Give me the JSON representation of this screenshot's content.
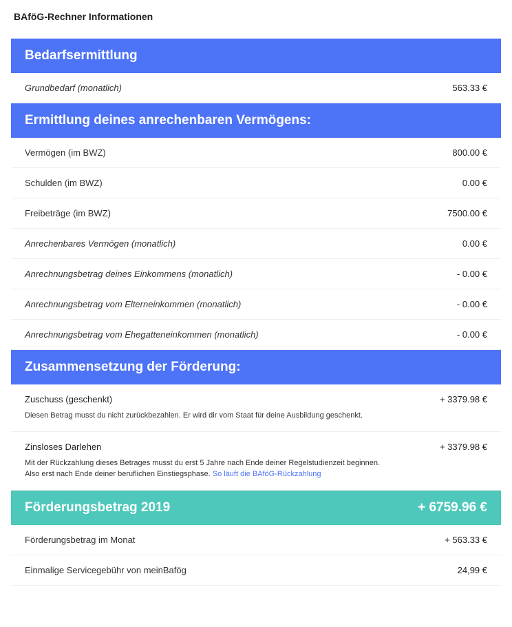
{
  "title": "BAföG-Rechner Informationen",
  "sections": {
    "bedarf": {
      "header": "Bedarfsermittlung",
      "rows": [
        {
          "label": "Grundbedarf (monatlich)",
          "value": "563.33 €",
          "italic": true
        }
      ]
    },
    "vermoegen": {
      "header": "Ermittlung deines anrechenbaren Vermögens:",
      "rows": [
        {
          "label": "Vermögen (im BWZ)",
          "value": "800.00 €",
          "italic": false
        },
        {
          "label": "Schulden (im BWZ)",
          "value": "0.00 €",
          "italic": false
        },
        {
          "label": "Freibeträge (im BWZ)",
          "value": "7500.00 €",
          "italic": false
        },
        {
          "label": "Anrechenbares Vermögen (monatlich)",
          "value": "0.00 €",
          "italic": true
        },
        {
          "label": "Anrechnungsbetrag deines Einkommens (monatlich)",
          "value": "- 0.00 €",
          "italic": true
        },
        {
          "label": "Anrechnungsbetrag vom Elterneinkommen (monatlich)",
          "value": "- 0.00 €",
          "italic": true
        },
        {
          "label": "Anrechnungsbetrag vom Ehegatteneinkommen (monatlich)",
          "value": "- 0.00 €",
          "italic": true
        }
      ]
    },
    "foerderung": {
      "header": "Zusammensetzung der Förderung:",
      "zuschuss": {
        "label": "Zuschuss (geschenkt)",
        "value": "+ 3379.98 €",
        "note": "Diesen Betrag musst du nicht zurückbezahlen. Er wird dir vom Staat für deine Ausbildung geschenkt."
      },
      "darlehen": {
        "label": "Zinsloses Darlehen",
        "value": "+ 3379.98 €",
        "note1": "Mit der Rückzahlung dieses Betrages musst du erst 5 Jahre nach Ende deiner Regelstudienzeit beginnen.",
        "note2": "Also erst nach Ende deiner beruflichen Einstiegsphase. ",
        "link": "So läuft die BAföG-Rückzahlung"
      }
    },
    "betrag": {
      "header": "Förderungsbetrag 2019",
      "total": "+ 6759.96 €",
      "rows": [
        {
          "label": "Förderungsbetrag im Monat",
          "value": "+ 563.33 €"
        },
        {
          "label": "Einmalige Servicegebühr von meinBafög",
          "value": "24,99 €"
        }
      ]
    }
  }
}
